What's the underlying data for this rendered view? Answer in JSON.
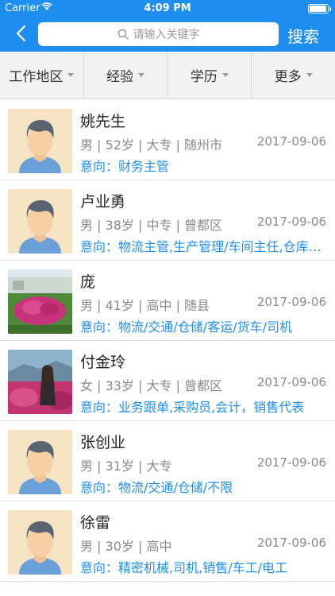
{
  "status_bar": {
    "carrier": "Carrier",
    "time": "4:09 PM"
  },
  "header": {
    "search_placeholder": "请输入关键字",
    "search_button": "搜索"
  },
  "filters": [
    {
      "label": "工作地区"
    },
    {
      "label": "经验"
    },
    {
      "label": "学历"
    },
    {
      "label": "更多"
    }
  ],
  "intent_prefix": "意向：",
  "candidates": [
    {
      "name": "姚先生",
      "info": "男 | 52岁 | 大专 | 随州市",
      "date": "2017-09-06",
      "intent": "财务主管",
      "avatar": "default-avatar"
    },
    {
      "name": "卢业勇",
      "info": "男 | 38岁 | 中专 | 曾都区",
      "date": "2017-09-06",
      "intent": "物流主管,生产管理/车间主任,仓库管理员",
      "avatar": "default-avatar"
    },
    {
      "name": "庞",
      "info": "男 | 41岁 | 高中 | 随县",
      "date": "2017-09-06",
      "intent": "物流/交通/仓储/客运/货车/司机",
      "avatar": "flower-photo"
    },
    {
      "name": "付金玲",
      "info": "女 | 33岁 | 大专 | 曾都区",
      "date": "2017-09-06",
      "intent": "业务跟单,采购员,会计，销售代表",
      "avatar": "woman-photo"
    },
    {
      "name": "张创业",
      "info": "男 | 31岁 | 大专",
      "date": "2017-09-06",
      "intent": "物流/交通/仓储/不限",
      "avatar": "default-avatar"
    },
    {
      "name": "徐雷",
      "info": "男 | 30岁 | 高中",
      "date": "2017-09-06",
      "intent": "精密机械,司机,销售/车工/电工",
      "avatar": "default-avatar"
    }
  ],
  "colors": {
    "brand": "#1e8ff0",
    "avatar_bg": "#f5e3c4",
    "skin": "#f7cfa4",
    "hair": "#5a6470",
    "shirt": "#6a9fd8"
  }
}
